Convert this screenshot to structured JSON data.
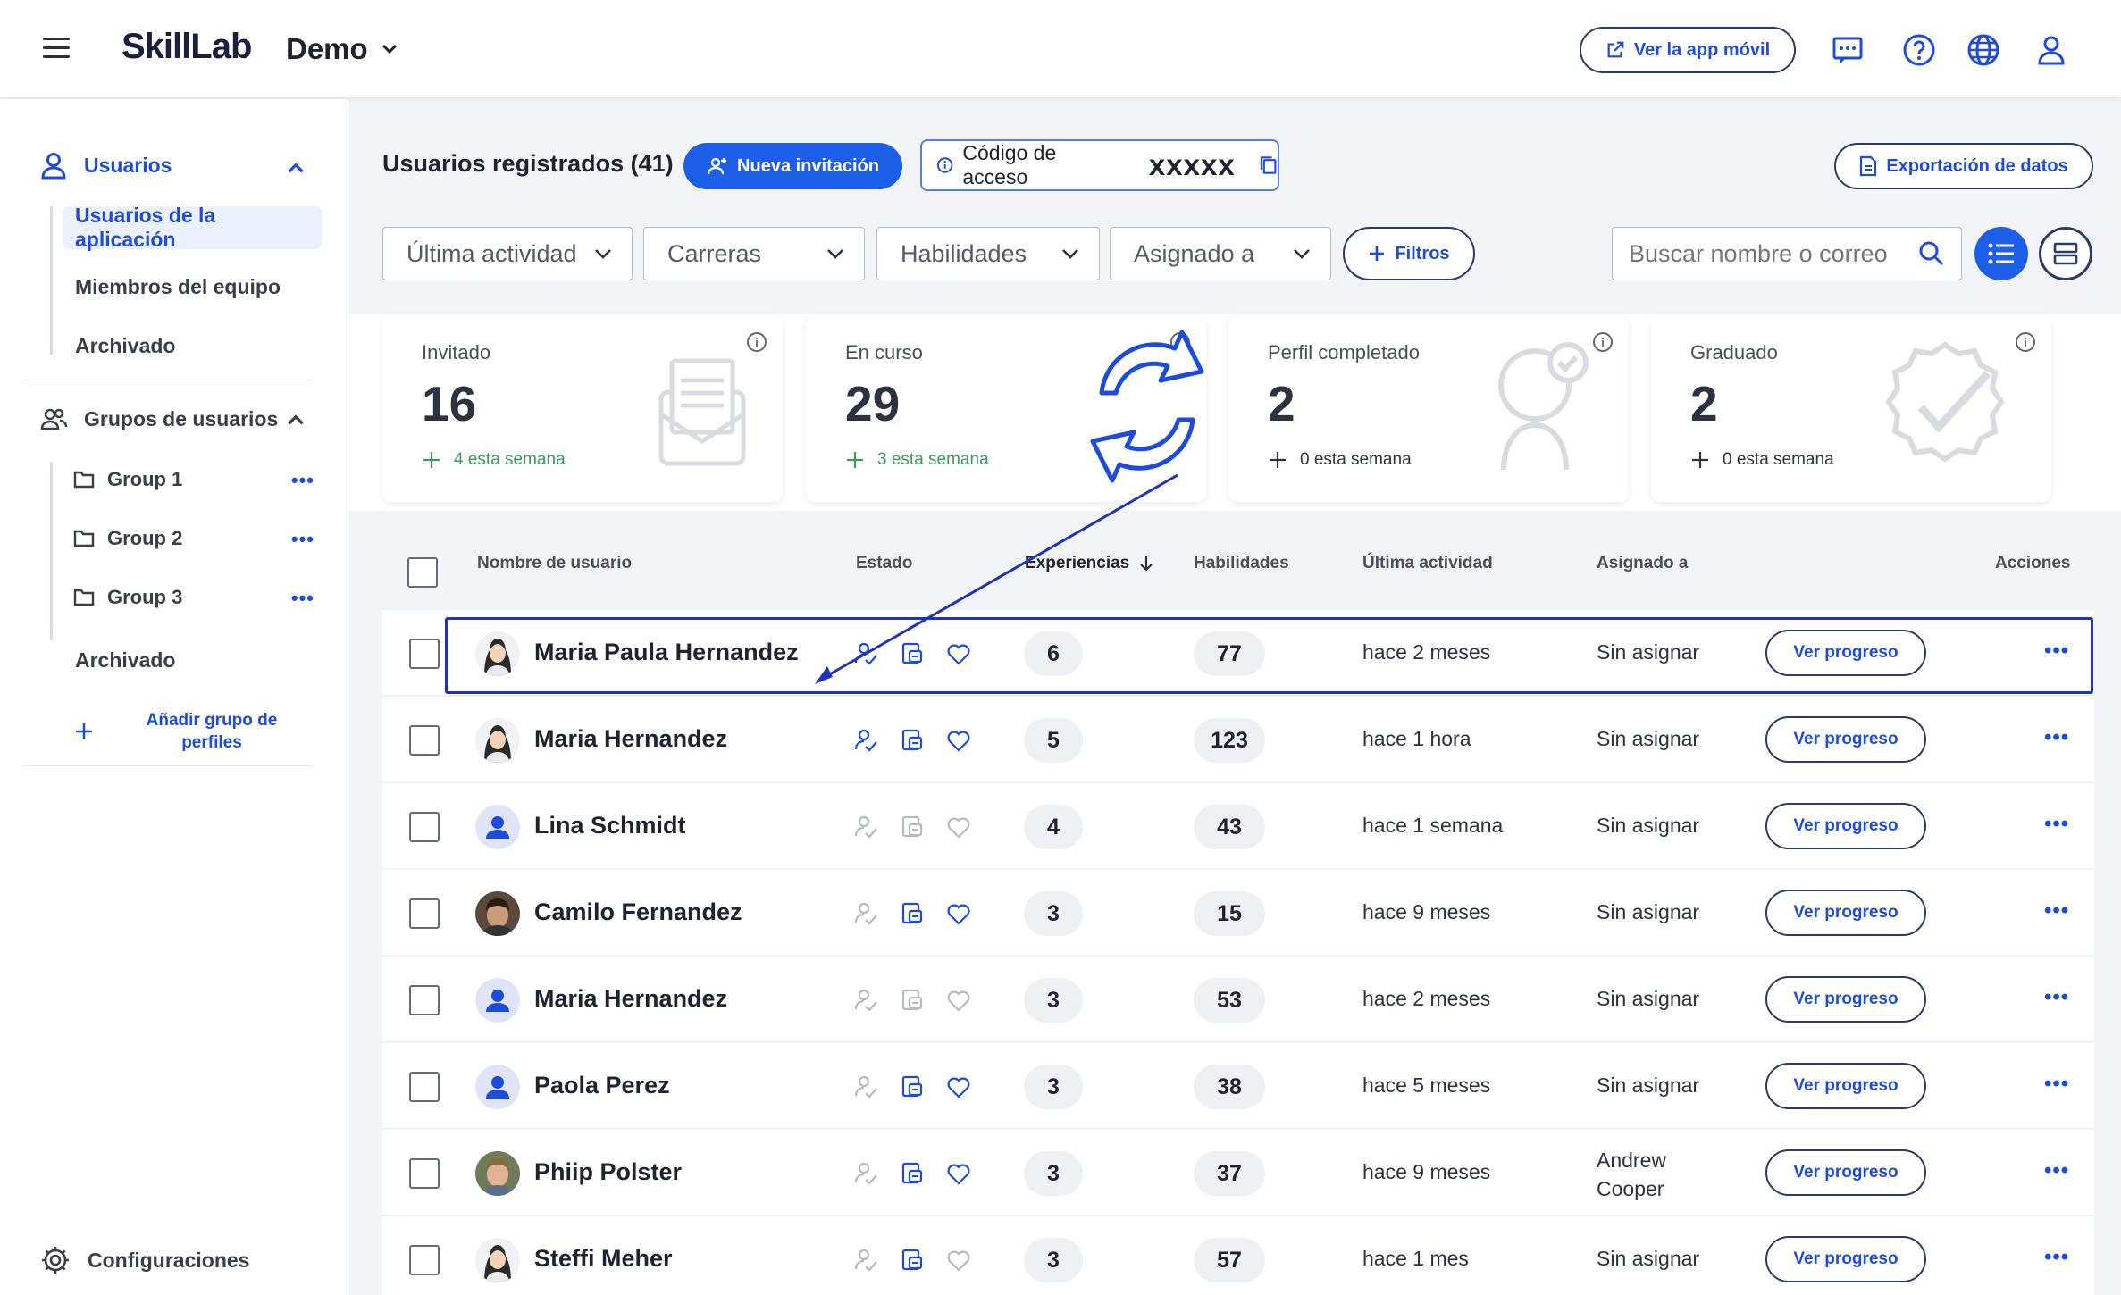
{
  "header": {
    "logo": "SkillLab",
    "org": "Demo",
    "mobile_app_label": "Ver la app móvil",
    "icons": [
      "chat-icon",
      "help-icon",
      "globe-icon",
      "user-icon"
    ]
  },
  "sidebar": {
    "users_label": "Usuarios",
    "user_items": [
      {
        "label": "Usuarios de la aplicación",
        "active": true
      },
      {
        "label": "Miembros del equipo",
        "active": false
      },
      {
        "label": "Archivado",
        "active": false
      }
    ],
    "groups_label": "Grupos de usuarios",
    "groups": [
      "Group 1",
      "Group 2",
      "Group 3"
    ],
    "groups_archived": "Archivado",
    "add_group_label": "Añadir grupo de perfiles",
    "settings_label": "Configuraciones"
  },
  "main": {
    "title": "Usuarios registrados (41)",
    "new_invite_label": "Nueva invitación",
    "access_code_label": "Código de acceso",
    "access_code_value": "xxxxx",
    "export_label": "Exportación de datos",
    "filters": [
      "Última actividad",
      "Carreras",
      "Habilidades",
      "Asignado a"
    ],
    "filters_button": "Filtros",
    "search_placeholder": "Buscar nombre o correo"
  },
  "stats": [
    {
      "label": "Invitado",
      "value": "16",
      "week": "4 esta semana",
      "week_color": "#3a9a5b"
    },
    {
      "label": "En curso",
      "value": "29",
      "week": "3 esta semana",
      "week_color": "#3a9a5b"
    },
    {
      "label": "Perfil completado",
      "value": "2",
      "week": "0 esta semana",
      "week_color": "#2d3240"
    },
    {
      "label": "Graduado",
      "value": "2",
      "week": "0 esta semana",
      "week_color": "#2d3240"
    }
  ],
  "table": {
    "columns": [
      "Nombre de usuario",
      "Estado",
      "Experiencias",
      "Habilidades",
      "Última actividad",
      "Asignado a",
      "Acciones"
    ],
    "view_progress_label": "Ver progreso",
    "rows": [
      {
        "name": "Maria Paula Hernandez",
        "avatar": "female",
        "status": [
          1,
          1,
          1
        ],
        "exp": "6",
        "skills": "77",
        "activity": "hace 2 meses",
        "assigned": "Sin asignar"
      },
      {
        "name": "Maria Hernandez",
        "avatar": "female",
        "status": [
          1,
          1,
          1
        ],
        "exp": "5",
        "skills": "123",
        "activity": "hace 1 hora",
        "assigned": "Sin asignar"
      },
      {
        "name": "Lina Schmidt",
        "avatar": "generic",
        "status": [
          0,
          0,
          0
        ],
        "exp": "4",
        "skills": "43",
        "activity": "hace 1 semana",
        "assigned": "Sin asignar"
      },
      {
        "name": "Camilo Fernandez",
        "avatar": "photo1",
        "status": [
          0,
          1,
          1
        ],
        "exp": "3",
        "skills": "15",
        "activity": "hace 9 meses",
        "assigned": "Sin asignar"
      },
      {
        "name": "Maria Hernandez",
        "avatar": "generic",
        "status": [
          0,
          0,
          0
        ],
        "exp": "3",
        "skills": "53",
        "activity": "hace 2 meses",
        "assigned": "Sin asignar"
      },
      {
        "name": "Paola Perez",
        "avatar": "generic",
        "status": [
          0,
          1,
          1
        ],
        "exp": "3",
        "skills": "38",
        "activity": "hace 5 meses",
        "assigned": "Sin asignar"
      },
      {
        "name": "Phiip Polster",
        "avatar": "photo2",
        "status": [
          0,
          1,
          1
        ],
        "exp": "3",
        "skills": "37",
        "activity": "hace 9 meses",
        "assigned": "Andrew Cooper"
      },
      {
        "name": "Steffi Meher",
        "avatar": "female",
        "status": [
          0,
          1,
          0
        ],
        "exp": "3",
        "skills": "57",
        "activity": "hace 1 mes",
        "assigned": "Sin asignar"
      }
    ]
  },
  "colors": {
    "accent": "#1d5fe8",
    "link": "#1d4bdb",
    "highlight": "#2133b8",
    "green": "#3a9a5b"
  }
}
